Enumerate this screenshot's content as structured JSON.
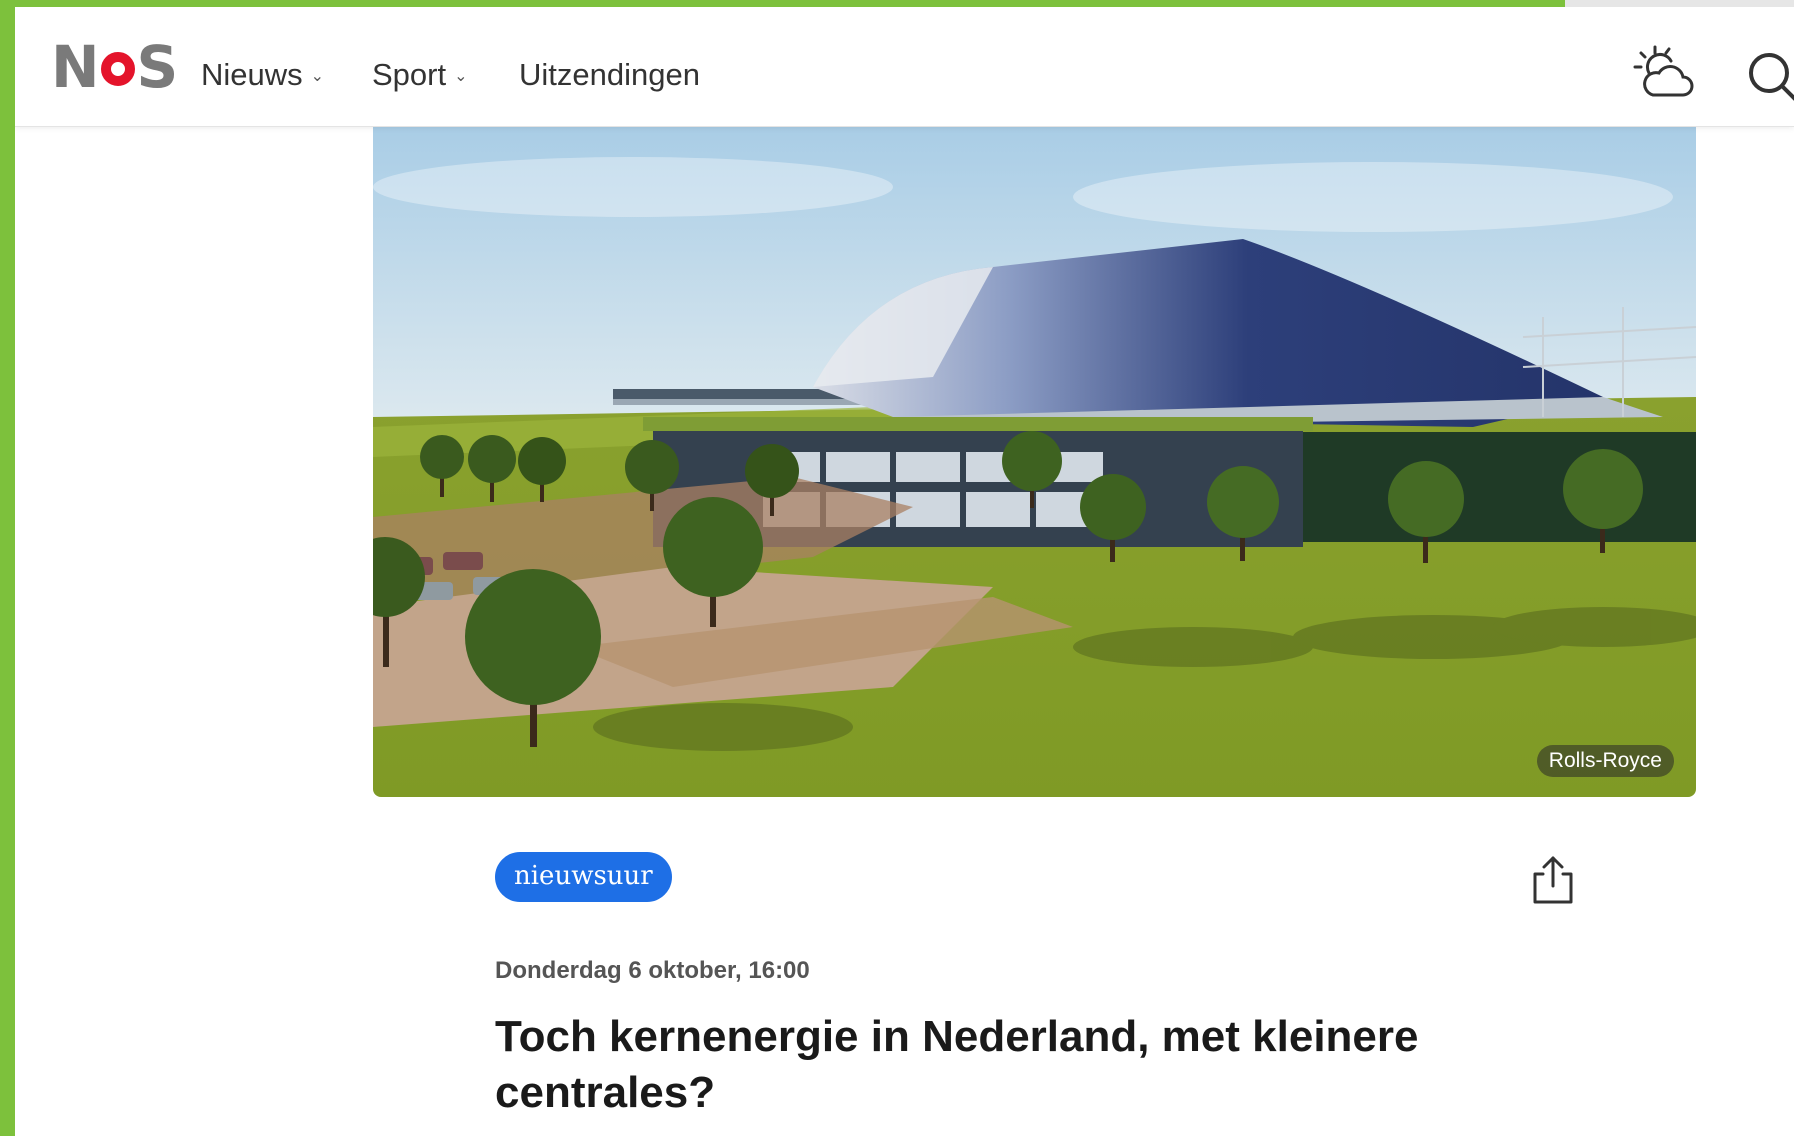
{
  "brand": {
    "logo_letters": [
      "N",
      "S"
    ],
    "logo_text": "NOS",
    "accent_color": "#e4142b",
    "frame_color": "#7dc13c"
  },
  "nav": {
    "items": [
      {
        "label": "Nieuws",
        "has_dropdown": true
      },
      {
        "label": "Sport",
        "has_dropdown": true
      },
      {
        "label": "Uitzendingen",
        "has_dropdown": false
      }
    ],
    "icons": [
      "weather-icon",
      "search-icon"
    ]
  },
  "hero": {
    "credit": "Rolls-Royce"
  },
  "article": {
    "tag": "nieuwsuur",
    "tag_color": "#1e6fe6",
    "date": "Donderdag 6 oktober, 16:00",
    "headline": "Toch kernenergie in Nederland, met kleinere centrales?"
  }
}
